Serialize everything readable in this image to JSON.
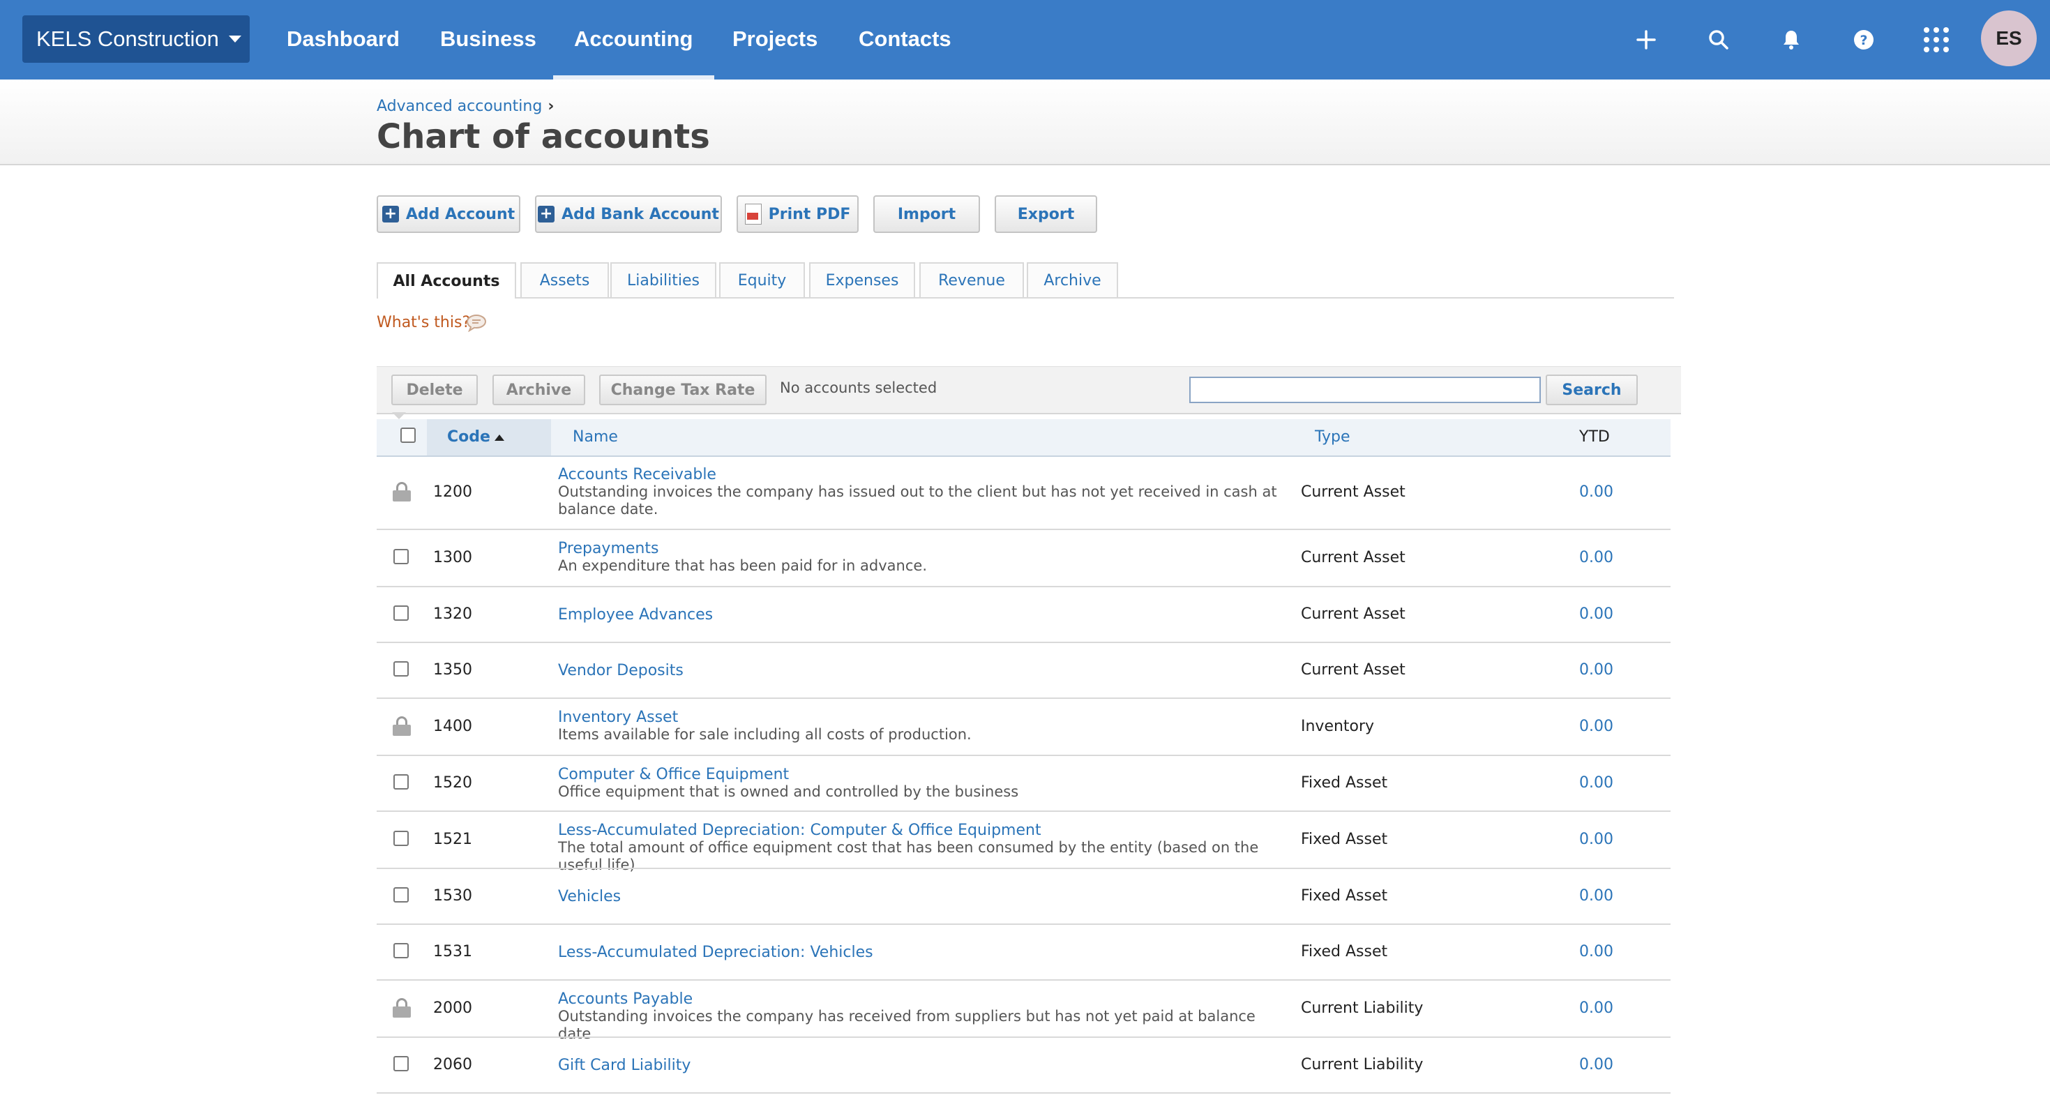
{
  "org": {
    "name": "KELS Construction"
  },
  "nav": {
    "items": [
      {
        "label": "Dashboard"
      },
      {
        "label": "Business"
      },
      {
        "label": "Accounting"
      },
      {
        "label": "Projects"
      },
      {
        "label": "Contacts"
      }
    ],
    "active": "Accounting",
    "icons": [
      "plus-icon",
      "search-icon",
      "bell-icon",
      "help-icon",
      "apps-grid-icon"
    ],
    "avatar_initials": "ES"
  },
  "header": {
    "breadcrumb": "Advanced accounting",
    "title": "Chart of accounts"
  },
  "toolbar": {
    "add_account": "Add Account",
    "add_bank_account": "Add Bank Account",
    "print_pdf": "Print PDF",
    "import": "Import",
    "export": "Export"
  },
  "tabs": [
    {
      "label": "All Accounts"
    },
    {
      "label": "Assets"
    },
    {
      "label": "Liabilities"
    },
    {
      "label": "Equity"
    },
    {
      "label": "Expenses"
    },
    {
      "label": "Revenue"
    },
    {
      "label": "Archive"
    }
  ],
  "whats_this": "What's this?",
  "actions": {
    "delete": "Delete",
    "archive": "Archive",
    "change_tax_rate": "Change Tax Rate",
    "selection_status": "No accounts selected",
    "search_value": "",
    "search_button": "Search"
  },
  "table": {
    "columns": {
      "code": "Code",
      "name": "Name",
      "type": "Type",
      "ytd": "YTD"
    },
    "rows": [
      {
        "code": "1200",
        "locked": true,
        "name": "Accounts Receivable",
        "desc": "Outstanding invoices the company has issued out to the client but has not yet received in cash at balance date.",
        "type": "Current Asset",
        "ytd": "0.00"
      },
      {
        "code": "1300",
        "locked": false,
        "name": "Prepayments",
        "desc": "An expenditure that has been paid for in advance.",
        "type": "Current Asset",
        "ytd": "0.00"
      },
      {
        "code": "1320",
        "locked": false,
        "name": "Employee Advances",
        "desc": "",
        "type": "Current Asset",
        "ytd": "0.00"
      },
      {
        "code": "1350",
        "locked": false,
        "name": "Vendor Deposits",
        "desc": "",
        "type": "Current Asset",
        "ytd": "0.00"
      },
      {
        "code": "1400",
        "locked": true,
        "name": "Inventory Asset",
        "desc": "Items available for sale including all costs of production.",
        "type": "Inventory",
        "ytd": "0.00"
      },
      {
        "code": "1520",
        "locked": false,
        "name": "Computer & Office Equipment",
        "desc": "Office equipment that is owned and controlled by the business",
        "type": "Fixed Asset",
        "ytd": "0.00"
      },
      {
        "code": "1521",
        "locked": false,
        "name": "Less-Accumulated Depreciation: Computer & Office Equipment",
        "desc": "The total amount of office equipment cost that has been consumed by the entity (based on the useful life)",
        "type": "Fixed Asset",
        "ytd": "0.00"
      },
      {
        "code": "1530",
        "locked": false,
        "name": "Vehicles",
        "desc": "",
        "type": "Fixed Asset",
        "ytd": "0.00"
      },
      {
        "code": "1531",
        "locked": false,
        "name": "Less-Accumulated Depreciation: Vehicles",
        "desc": "",
        "type": "Fixed Asset",
        "ytd": "0.00"
      },
      {
        "code": "2000",
        "locked": true,
        "name": "Accounts Payable",
        "desc": "Outstanding invoices the company has received from suppliers but has not yet paid at balance date",
        "type": "Current Liability",
        "ytd": "0.00"
      },
      {
        "code": "2060",
        "locked": false,
        "name": "Gift Card Liability",
        "desc": "",
        "type": "Current Liability",
        "ytd": "0.00"
      }
    ]
  }
}
